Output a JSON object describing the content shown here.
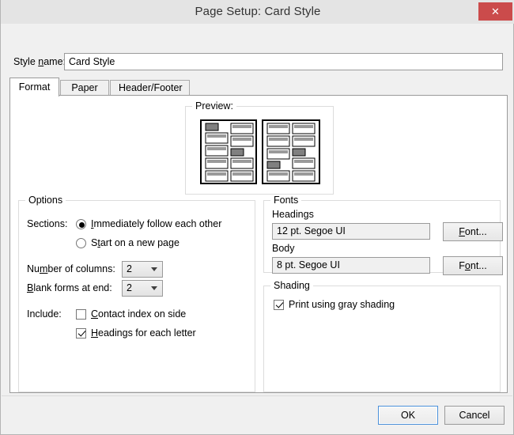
{
  "window": {
    "title": "Page Setup: Card Style",
    "close_icon": "close-icon",
    "close_glyph": "✕"
  },
  "style_name": {
    "label_pre": "Style ",
    "label_accel": "n",
    "label_post": "ame:",
    "value": "Card Style"
  },
  "tabs": [
    {
      "label": "Format",
      "active": true
    },
    {
      "label": "Paper",
      "active": false
    },
    {
      "label": "Header/Footer",
      "active": false
    }
  ],
  "preview": {
    "title": "Preview:"
  },
  "options": {
    "title": "Options",
    "sections_label": "Sections:",
    "radio_1": {
      "pre": "",
      "accel": "I",
      "post": "mmediately follow each other",
      "checked": true
    },
    "radio_2": {
      "pre": "S",
      "accel": "t",
      "post": "art on a new page",
      "checked": false
    },
    "columns_label": {
      "pre": "Nu",
      "accel": "m",
      "post": "ber of columns:"
    },
    "columns_value": "2",
    "blank_label": {
      "pre": "",
      "accel": "B",
      "post": "lank forms at end:"
    },
    "blank_value": "2",
    "include_label": "Include:",
    "check_1": {
      "pre": "",
      "accel": "C",
      "post": "ontact index on side",
      "checked": false
    },
    "check_2": {
      "pre": "",
      "accel": "H",
      "post": "eadings for each letter",
      "checked": true
    }
  },
  "fonts": {
    "title": "Fonts",
    "headings_label": "Headings",
    "headings_value": "12 pt. Segoe UI",
    "headings_button": {
      "pre": "",
      "accel": "F",
      "post": "ont..."
    },
    "body_label": "Body",
    "body_value": "8 pt. Segoe UI",
    "body_button": {
      "pre": "F",
      "accel": "o",
      "post": "nt..."
    }
  },
  "shading": {
    "title": "Shading",
    "check": {
      "pre": "Print using ",
      "accel": "g",
      "post": "ray shading",
      "checked": true
    }
  },
  "footer": {
    "ok_label": "OK",
    "cancel_label": "Cancel"
  },
  "colors": {
    "titlebar": "#e4e4e4",
    "close_red": "#cb4b4b",
    "dialog_bg": "#f0f0f0",
    "panel_bg": "#ffffff",
    "focus_blue": "#4a90d9",
    "shade_gray": "#808080"
  }
}
